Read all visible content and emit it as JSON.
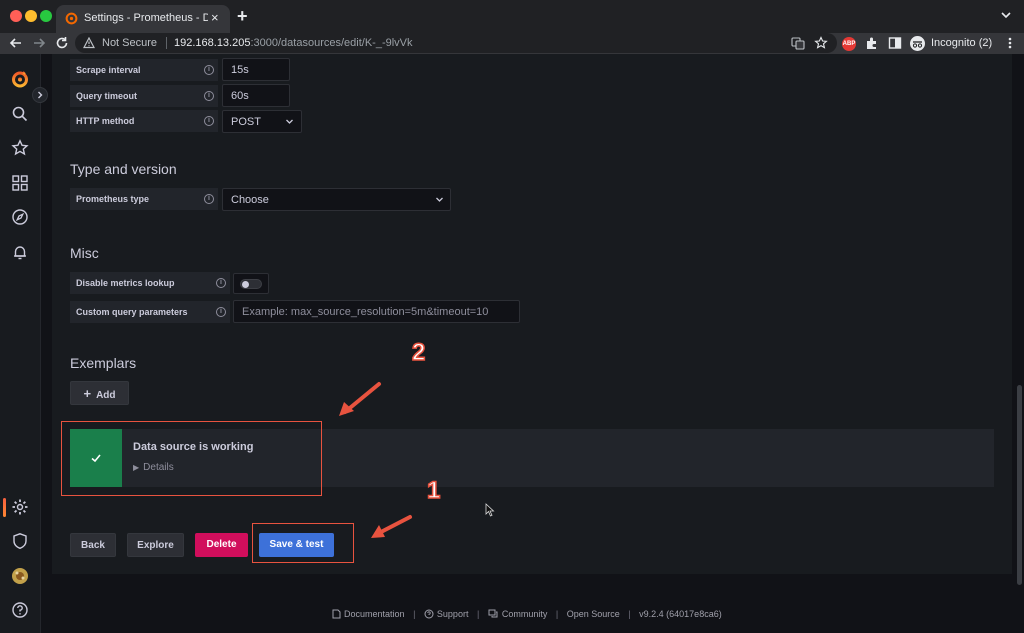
{
  "browser": {
    "tab_title": "Settings - Prometheus - Data s",
    "tab_close": "×",
    "new_tab": "+",
    "security_label": "Not Secure",
    "url_host": "192.168.13.205",
    "url_rest": ":3000/datasources/edit/K-_-9lvVk",
    "abp_label": "ABP",
    "profile_label": "Incognito (2)"
  },
  "http": {
    "scrape_interval_label": "Scrape interval",
    "scrape_interval_value": "15s",
    "query_timeout_label": "Query timeout",
    "query_timeout_value": "60s",
    "http_method_label": "HTTP method",
    "http_method_value": "POST"
  },
  "type_version": {
    "title": "Type and version",
    "prometheus_type_label": "Prometheus type",
    "prometheus_type_value": "Choose"
  },
  "misc": {
    "title": "Misc",
    "disable_metrics_lookup_label": "Disable metrics lookup",
    "disable_metrics_lookup_on": false,
    "custom_query_params_label": "Custom query parameters",
    "custom_query_params_placeholder": "Example: max_source_resolution=5m&timeout=10"
  },
  "exemplars": {
    "title": "Exemplars",
    "add_label": "Add"
  },
  "alert": {
    "title": "Data source is working",
    "details_label": "Details"
  },
  "actions": {
    "back": "Back",
    "explore": "Explore",
    "delete": "Delete",
    "save_test": "Save & test"
  },
  "annotations": {
    "step_1": "1",
    "step_2": "2",
    "color": "#e8533f"
  },
  "footer": {
    "documentation": "Documentation",
    "support": "Support",
    "community": "Community",
    "open_source": "Open Source",
    "version": "v9.2.4 (64017e8ca6)",
    "separator": "|"
  },
  "colors": {
    "accent_primary": "#3d71d9",
    "danger": "#d10e5c",
    "success": "#1a7f4b",
    "brand": "#f55f3e"
  }
}
